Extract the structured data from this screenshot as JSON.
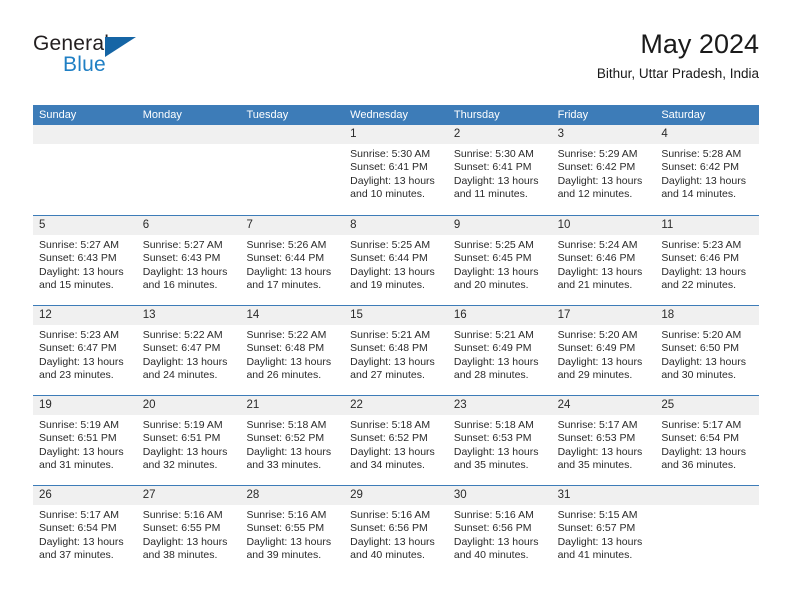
{
  "brand": {
    "name_part1": "General",
    "name_part2": "Blue"
  },
  "header": {
    "title": "May 2024",
    "subtitle": "Bithur, Uttar Pradesh, India"
  },
  "colors": {
    "header_blue": "#3d7cb8",
    "logo_blue": "#1f7fc4",
    "day_number_bg": "#f0f0f0"
  },
  "weekdays": [
    "Sunday",
    "Monday",
    "Tuesday",
    "Wednesday",
    "Thursday",
    "Friday",
    "Saturday"
  ],
  "weeks": [
    [
      {
        "day": "",
        "sunrise": "",
        "sunset": "",
        "daylight": ""
      },
      {
        "day": "",
        "sunrise": "",
        "sunset": "",
        "daylight": ""
      },
      {
        "day": "",
        "sunrise": "",
        "sunset": "",
        "daylight": ""
      },
      {
        "day": "1",
        "sunrise": "Sunrise: 5:30 AM",
        "sunset": "Sunset: 6:41 PM",
        "daylight": "Daylight: 13 hours and 10 minutes."
      },
      {
        "day": "2",
        "sunrise": "Sunrise: 5:30 AM",
        "sunset": "Sunset: 6:41 PM",
        "daylight": "Daylight: 13 hours and 11 minutes."
      },
      {
        "day": "3",
        "sunrise": "Sunrise: 5:29 AM",
        "sunset": "Sunset: 6:42 PM",
        "daylight": "Daylight: 13 hours and 12 minutes."
      },
      {
        "day": "4",
        "sunrise": "Sunrise: 5:28 AM",
        "sunset": "Sunset: 6:42 PM",
        "daylight": "Daylight: 13 hours and 14 minutes."
      }
    ],
    [
      {
        "day": "5",
        "sunrise": "Sunrise: 5:27 AM",
        "sunset": "Sunset: 6:43 PM",
        "daylight": "Daylight: 13 hours and 15 minutes."
      },
      {
        "day": "6",
        "sunrise": "Sunrise: 5:27 AM",
        "sunset": "Sunset: 6:43 PM",
        "daylight": "Daylight: 13 hours and 16 minutes."
      },
      {
        "day": "7",
        "sunrise": "Sunrise: 5:26 AM",
        "sunset": "Sunset: 6:44 PM",
        "daylight": "Daylight: 13 hours and 17 minutes."
      },
      {
        "day": "8",
        "sunrise": "Sunrise: 5:25 AM",
        "sunset": "Sunset: 6:44 PM",
        "daylight": "Daylight: 13 hours and 19 minutes."
      },
      {
        "day": "9",
        "sunrise": "Sunrise: 5:25 AM",
        "sunset": "Sunset: 6:45 PM",
        "daylight": "Daylight: 13 hours and 20 minutes."
      },
      {
        "day": "10",
        "sunrise": "Sunrise: 5:24 AM",
        "sunset": "Sunset: 6:46 PM",
        "daylight": "Daylight: 13 hours and 21 minutes."
      },
      {
        "day": "11",
        "sunrise": "Sunrise: 5:23 AM",
        "sunset": "Sunset: 6:46 PM",
        "daylight": "Daylight: 13 hours and 22 minutes."
      }
    ],
    [
      {
        "day": "12",
        "sunrise": "Sunrise: 5:23 AM",
        "sunset": "Sunset: 6:47 PM",
        "daylight": "Daylight: 13 hours and 23 minutes."
      },
      {
        "day": "13",
        "sunrise": "Sunrise: 5:22 AM",
        "sunset": "Sunset: 6:47 PM",
        "daylight": "Daylight: 13 hours and 24 minutes."
      },
      {
        "day": "14",
        "sunrise": "Sunrise: 5:22 AM",
        "sunset": "Sunset: 6:48 PM",
        "daylight": "Daylight: 13 hours and 26 minutes."
      },
      {
        "day": "15",
        "sunrise": "Sunrise: 5:21 AM",
        "sunset": "Sunset: 6:48 PM",
        "daylight": "Daylight: 13 hours and 27 minutes."
      },
      {
        "day": "16",
        "sunrise": "Sunrise: 5:21 AM",
        "sunset": "Sunset: 6:49 PM",
        "daylight": "Daylight: 13 hours and 28 minutes."
      },
      {
        "day": "17",
        "sunrise": "Sunrise: 5:20 AM",
        "sunset": "Sunset: 6:49 PM",
        "daylight": "Daylight: 13 hours and 29 minutes."
      },
      {
        "day": "18",
        "sunrise": "Sunrise: 5:20 AM",
        "sunset": "Sunset: 6:50 PM",
        "daylight": "Daylight: 13 hours and 30 minutes."
      }
    ],
    [
      {
        "day": "19",
        "sunrise": "Sunrise: 5:19 AM",
        "sunset": "Sunset: 6:51 PM",
        "daylight": "Daylight: 13 hours and 31 minutes."
      },
      {
        "day": "20",
        "sunrise": "Sunrise: 5:19 AM",
        "sunset": "Sunset: 6:51 PM",
        "daylight": "Daylight: 13 hours and 32 minutes."
      },
      {
        "day": "21",
        "sunrise": "Sunrise: 5:18 AM",
        "sunset": "Sunset: 6:52 PM",
        "daylight": "Daylight: 13 hours and 33 minutes."
      },
      {
        "day": "22",
        "sunrise": "Sunrise: 5:18 AM",
        "sunset": "Sunset: 6:52 PM",
        "daylight": "Daylight: 13 hours and 34 minutes."
      },
      {
        "day": "23",
        "sunrise": "Sunrise: 5:18 AM",
        "sunset": "Sunset: 6:53 PM",
        "daylight": "Daylight: 13 hours and 35 minutes."
      },
      {
        "day": "24",
        "sunrise": "Sunrise: 5:17 AM",
        "sunset": "Sunset: 6:53 PM",
        "daylight": "Daylight: 13 hours and 35 minutes."
      },
      {
        "day": "25",
        "sunrise": "Sunrise: 5:17 AM",
        "sunset": "Sunset: 6:54 PM",
        "daylight": "Daylight: 13 hours and 36 minutes."
      }
    ],
    [
      {
        "day": "26",
        "sunrise": "Sunrise: 5:17 AM",
        "sunset": "Sunset: 6:54 PM",
        "daylight": "Daylight: 13 hours and 37 minutes."
      },
      {
        "day": "27",
        "sunrise": "Sunrise: 5:16 AM",
        "sunset": "Sunset: 6:55 PM",
        "daylight": "Daylight: 13 hours and 38 minutes."
      },
      {
        "day": "28",
        "sunrise": "Sunrise: 5:16 AM",
        "sunset": "Sunset: 6:55 PM",
        "daylight": "Daylight: 13 hours and 39 minutes."
      },
      {
        "day": "29",
        "sunrise": "Sunrise: 5:16 AM",
        "sunset": "Sunset: 6:56 PM",
        "daylight": "Daylight: 13 hours and 40 minutes."
      },
      {
        "day": "30",
        "sunrise": "Sunrise: 5:16 AM",
        "sunset": "Sunset: 6:56 PM",
        "daylight": "Daylight: 13 hours and 40 minutes."
      },
      {
        "day": "31",
        "sunrise": "Sunrise: 5:15 AM",
        "sunset": "Sunset: 6:57 PM",
        "daylight": "Daylight: 13 hours and 41 minutes."
      },
      {
        "day": "",
        "sunrise": "",
        "sunset": "",
        "daylight": ""
      }
    ]
  ]
}
